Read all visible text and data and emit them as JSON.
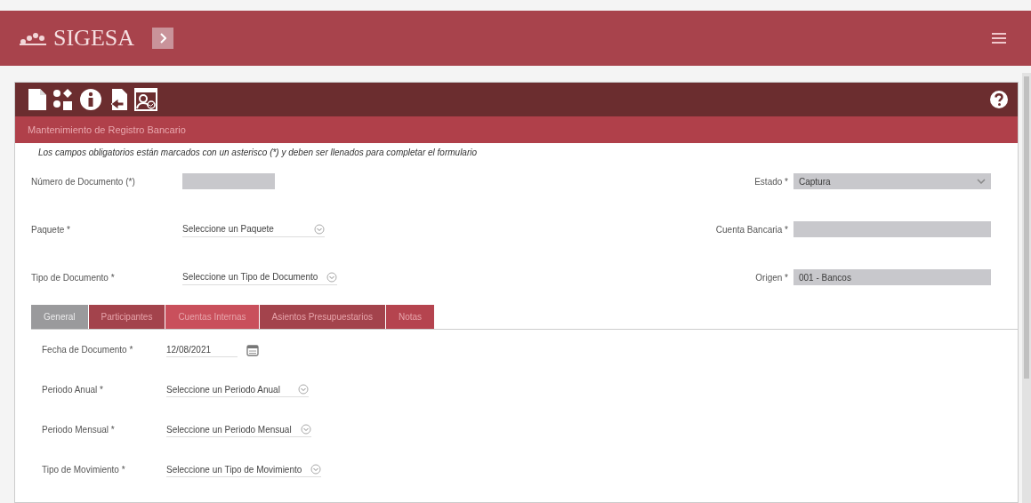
{
  "app": {
    "title": "SIGESA"
  },
  "form": {
    "title": "Mantenimiento de Registro Bancario",
    "notice": "Los campos obligatorios están marcados con un asterisco (*) y deben ser llenados para completar el formulario",
    "left_fields": [
      {
        "label": "Número de Documento (*)",
        "kind": "readonly"
      },
      {
        "label": "Paquete *",
        "kind": "select",
        "value": "Seleccione un Paquete"
      },
      {
        "label": "Tipo de Documento *",
        "kind": "select",
        "value": "Seleccione un Tipo de Documento"
      }
    ],
    "right_fields": [
      {
        "label": "Estado *",
        "kind": "readonly-select",
        "value": "Captura"
      },
      {
        "label": "Cuenta Bancaria *",
        "kind": "readonly"
      },
      {
        "label": "Origen *",
        "kind": "readonly",
        "value": "001 - Bancos"
      }
    ],
    "tabs": [
      {
        "label": "General",
        "selected": true,
        "color": "#9a9a9c"
      },
      {
        "label": "Participantes",
        "selected": false,
        "color": "#a3434c"
      },
      {
        "label": "Cuentas Internas",
        "selected": false,
        "color": "#c9505c"
      },
      {
        "label": "Asientos Presupuestarios",
        "selected": false,
        "color": "#a3434c"
      },
      {
        "label": "Notas",
        "selected": false,
        "color": "#b5444f"
      }
    ],
    "tab_fields": [
      {
        "label": "Fecha de Documento *",
        "kind": "date",
        "value": "12/08/2021"
      },
      {
        "label": "Periodo Anual *",
        "kind": "select",
        "value": "Seleccione un Periodo Anual"
      },
      {
        "label": "Periodo Mensual *",
        "kind": "select",
        "value": "Seleccione un Periodo Mensual"
      },
      {
        "label": "Tipo de Movimiento *",
        "kind": "select",
        "value": "Seleccione un Tipo de Movimiento"
      }
    ]
  }
}
